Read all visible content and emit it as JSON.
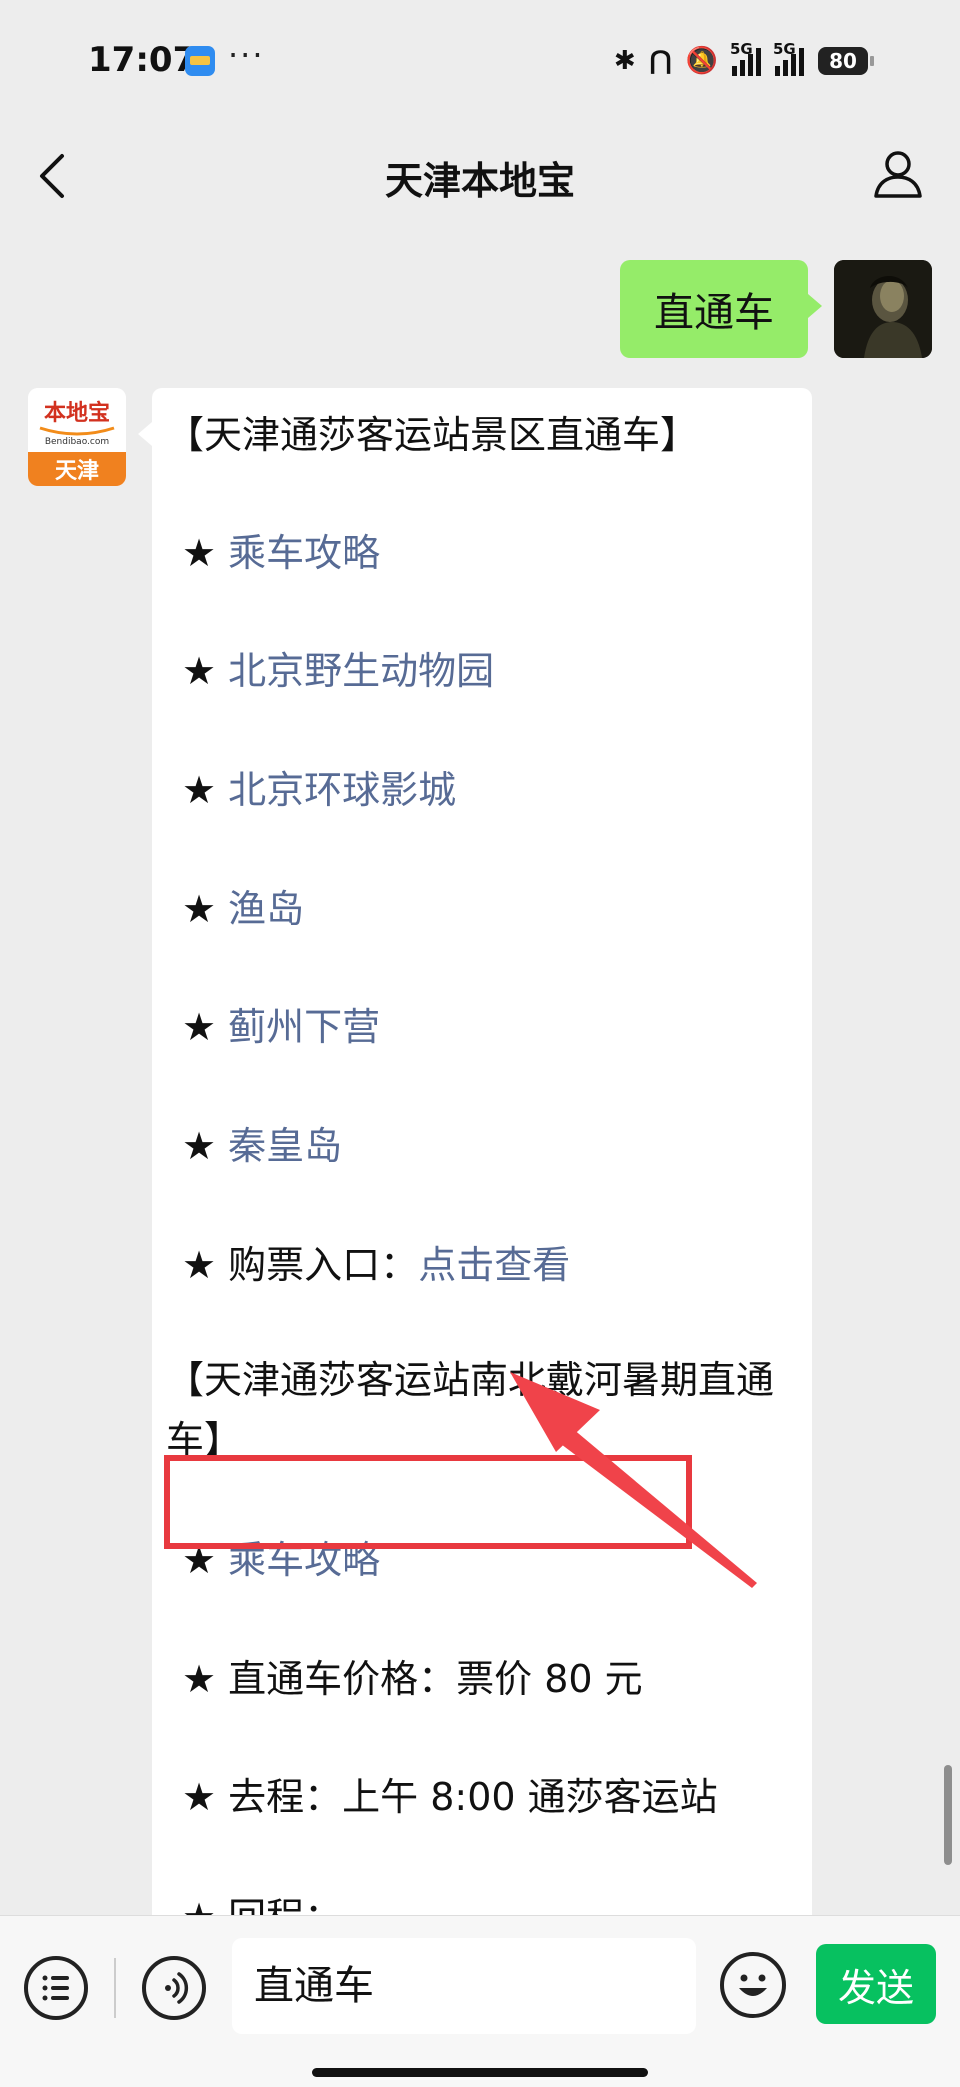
{
  "status_bar": {
    "time": "17:07",
    "more": "···",
    "signal_1": "5G",
    "signal_2": "5G",
    "battery": "80"
  },
  "header": {
    "title": "天津本地宝",
    "back_icon": "chevron-left-icon",
    "profile_icon": "person-icon"
  },
  "chat": {
    "outgoing_message": "直通车",
    "bot_logo": {
      "top": "本地宝",
      "domain": "Bendibao.com",
      "city": "天津"
    },
    "incoming": {
      "section1_title": "【天津通莎客运站景区直通车】",
      "section1_items": [
        {
          "star": "★",
          "text": "乘车攻略"
        },
        {
          "star": "★",
          "text": "北京野生动物园"
        },
        {
          "star": "★",
          "text": "北京环球影城"
        },
        {
          "star": "★",
          "text": "渔岛"
        },
        {
          "star": "★",
          "text": "蓟州下营"
        },
        {
          "star": "★",
          "text": "秦皇岛"
        }
      ],
      "ticket": {
        "star": "★",
        "label": "购票入口：",
        "link": "点击查看"
      },
      "section2_title": "【天津通莎客运站南北戴河暑期直通车】",
      "section2_items": [
        {
          "star": "★",
          "text": "乘车攻略"
        },
        {
          "star": "★",
          "text": "直通车价格：票价 80 元"
        },
        {
          "star": "★",
          "text": "去程：上午 8:00  通莎客运站"
        },
        {
          "star": "★",
          "text": "回程："
        }
      ]
    }
  },
  "input_bar": {
    "menu_icon": "list-icon",
    "voice_icon": "voice-icon",
    "input_value": "直通车",
    "emoji_icon": "smiley-icon",
    "send_label": "发送"
  },
  "colors": {
    "accent": "#07c160",
    "out_bubble": "#95ec69",
    "link": "#576b95",
    "highlight": "#e8393f"
  }
}
